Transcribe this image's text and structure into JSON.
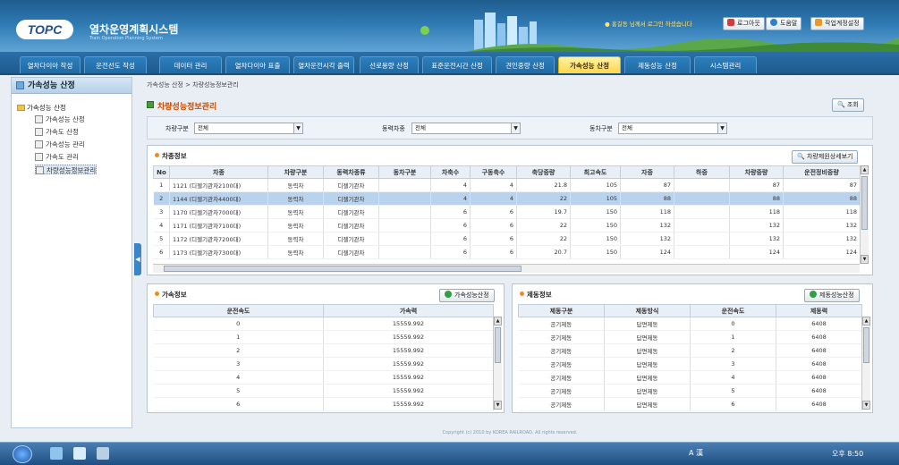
{
  "header": {
    "logo": "TOPC",
    "title": "열차운영계획시스템",
    "subtitle": "Train Operation Planning System",
    "user_info": "홍길동 님께서 로그인 하셨습니다",
    "logout": "로그아웃",
    "help": "도움말",
    "work_env": "작업계정설정"
  },
  "nav": {
    "tabs": [
      "열차다이아 작성",
      "운전선도 작성",
      "데이터 관리",
      "열차다이아 표출",
      "열차운전시각 출력",
      "선로용량 산정",
      "표준운전시간 산정",
      "견인중량 산정",
      "가속성능 산정",
      "제동성능 산정",
      "시스템관리"
    ],
    "active": "가속성능 산정"
  },
  "sidebar": {
    "header": "가속성능 산정",
    "root": "가속성능 산정",
    "items": [
      "가속성능 산정",
      "가속도 산정",
      "가속성능 관리",
      "가속도 관리",
      "차량성능정보관리"
    ],
    "selected": "차량성능정보관리"
  },
  "breadcrumb": "가속성능 산정 > 차량성능정보관리",
  "page_title": "차량성능정보관리",
  "buttons": {
    "search": "조회",
    "vehicle_detail": "차량제원상세보기",
    "accel_calc": "가속성능산정",
    "brake_calc": "제동성능산정"
  },
  "filters": [
    {
      "label": "차량구분",
      "value": "전체"
    },
    {
      "label": "동력차종",
      "value": "전체"
    },
    {
      "label": "동차구분",
      "value": "전체"
    }
  ],
  "vehicle": {
    "title": "차종정보",
    "columns": [
      "No",
      "차종",
      "차량구분",
      "동력차종류",
      "동차구분",
      "차축수",
      "구동축수",
      "축당중량",
      "최고속도",
      "자중",
      "하중",
      "차량중량",
      "운전정비중량"
    ],
    "rows": [
      [
        "1",
        "1121 (디젤기관차2100대)",
        "동력차",
        "디젤기관차",
        "",
        "4",
        "4",
        "21.8",
        "105",
        "87",
        "",
        "87",
        "87"
      ],
      [
        "2",
        "1144 (디젤기관차4400대)",
        "동력차",
        "디젤기관차",
        "",
        "4",
        "4",
        "22",
        "105",
        "88",
        "",
        "88",
        "88"
      ],
      [
        "3",
        "1170 (디젤기관차7000대)",
        "동력차",
        "디젤기관차",
        "",
        "6",
        "6",
        "19.7",
        "150",
        "118",
        "",
        "118",
        "118"
      ],
      [
        "4",
        "1171 (디젤기관차7100대)",
        "동력차",
        "디젤기관차",
        "",
        "6",
        "6",
        "22",
        "150",
        "132",
        "",
        "132",
        "132"
      ],
      [
        "5",
        "1172 (디젤기관차7200대)",
        "동력차",
        "디젤기관차",
        "",
        "6",
        "6",
        "22",
        "150",
        "132",
        "",
        "132",
        "132"
      ],
      [
        "6",
        "1173 (디젤기관차7300대)",
        "동력차",
        "디젤기관차",
        "",
        "6",
        "6",
        "20.7",
        "150",
        "124",
        "",
        "124",
        "124"
      ]
    ],
    "selected_row": 1
  },
  "accel": {
    "title": "가속정보",
    "columns": [
      "운전속도",
      "가속력"
    ],
    "rows": [
      [
        "0",
        "15559.992"
      ],
      [
        "1",
        "15559.992"
      ],
      [
        "2",
        "15559.992"
      ],
      [
        "3",
        "15559.992"
      ],
      [
        "4",
        "15559.992"
      ],
      [
        "5",
        "15559.992"
      ],
      [
        "6",
        "15559.992"
      ]
    ]
  },
  "brake": {
    "title": "제동정보",
    "columns": [
      "제동구분",
      "제동방식",
      "운전속도",
      "제동력"
    ],
    "rows": [
      [
        "공기제동",
        "답면제동",
        "0",
        "6408"
      ],
      [
        "공기제동",
        "답면제동",
        "1",
        "6408"
      ],
      [
        "공기제동",
        "답면제동",
        "2",
        "6408"
      ],
      [
        "공기제동",
        "답면제동",
        "3",
        "6408"
      ],
      [
        "공기제동",
        "답면제동",
        "4",
        "6408"
      ],
      [
        "공기제동",
        "답면제동",
        "5",
        "6408"
      ],
      [
        "공기제동",
        "답면제동",
        "6",
        "6408"
      ]
    ]
  },
  "footer": "Copyright (c) 2010 by KOREA RAILROAD. All rights reserved.",
  "taskbar": {
    "tray": "A 漢",
    "clock": "오후 8:50"
  },
  "colors": {
    "accent": "#2a6fa7",
    "active_tab": "#ffd54b",
    "selected_row": "#b9d3ef",
    "title": "#c44a00"
  }
}
